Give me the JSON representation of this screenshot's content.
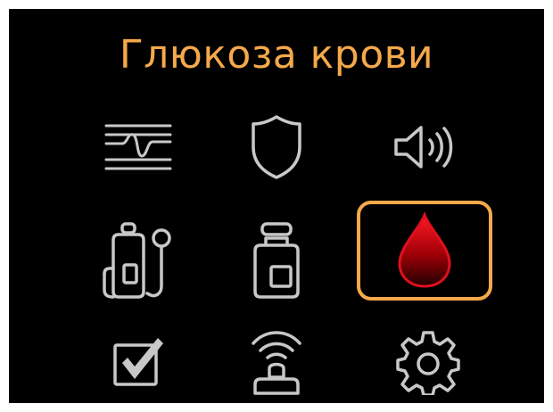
{
  "screen": {
    "title": "Глюкоза крови",
    "selected_item": "blood-glucose"
  },
  "menu": {
    "items": [
      {
        "id": "cgm-sensor",
        "icon": "sensor-graph-icon"
      },
      {
        "id": "alerts",
        "icon": "shield-icon"
      },
      {
        "id": "sound",
        "icon": "speaker-icon"
      },
      {
        "id": "pump",
        "icon": "pump-infusion-icon"
      },
      {
        "id": "insulin",
        "icon": "insulin-vial-icon"
      },
      {
        "id": "blood-glucose",
        "icon": "blood-drop-icon"
      },
      {
        "id": "tasks",
        "icon": "checkbox-icon"
      },
      {
        "id": "connection",
        "icon": "wireless-connection-icon"
      },
      {
        "id": "settings",
        "icon": "gear-icon"
      }
    ]
  },
  "colors": {
    "background": "#000000",
    "accent": "#f5a94a",
    "icon_stroke": "#c8c8c8",
    "drop_red": "#e0101c"
  }
}
